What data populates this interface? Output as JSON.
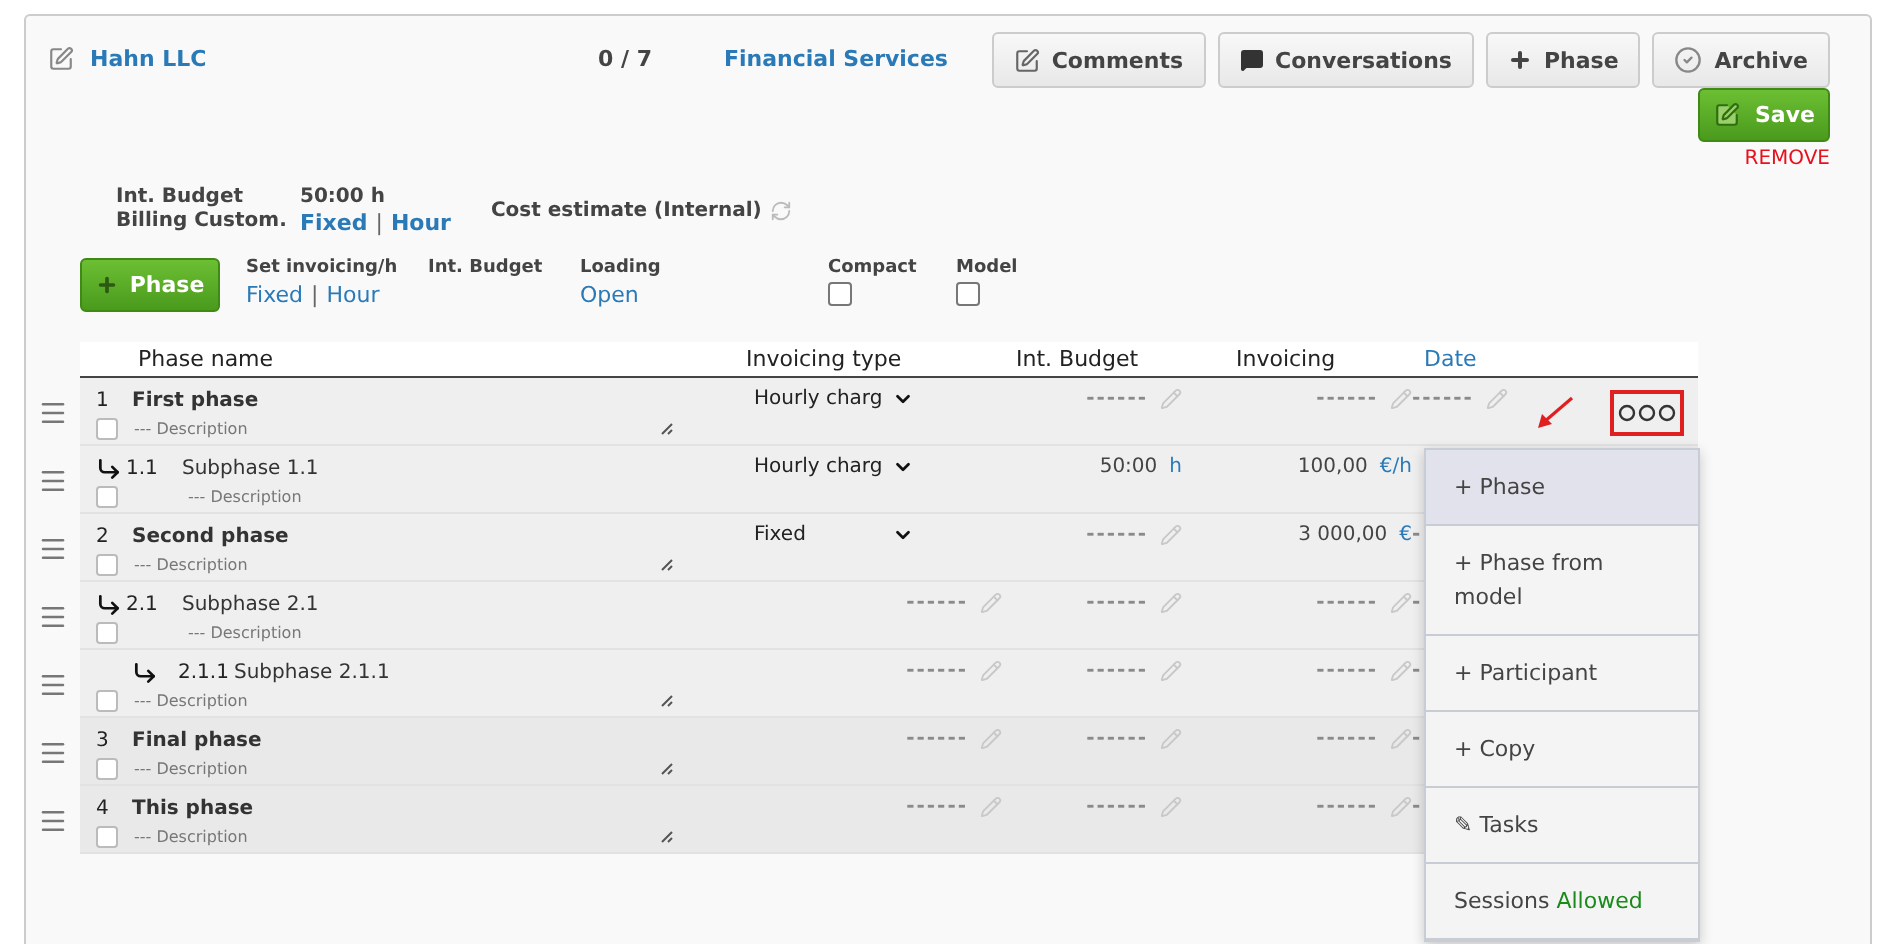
{
  "header": {
    "client": "Hahn LLC",
    "progress": "0 / 7",
    "category": "Financial Services"
  },
  "toolbar": [
    {
      "kind": "comments",
      "label": "Comments"
    },
    {
      "kind": "conversations",
      "label": "Conversations"
    },
    {
      "kind": "add",
      "label": "Phase"
    },
    {
      "kind": "archive",
      "label": "Archive"
    }
  ],
  "save": {
    "label": "Save",
    "remove": "REMOVE"
  },
  "summary": {
    "budget_label": "Int. Budget",
    "budget_value": "50:00 h",
    "billing_label": "Billing Custom.",
    "billing_options": [
      "Fixed",
      "Hour"
    ],
    "billing_separator": "|",
    "cost_estimate": "Cost estimate (Internal)"
  },
  "controls": {
    "add_phase": "Phase",
    "set_invoicing": {
      "label": "Set invoicing/h",
      "options": [
        "Fixed",
        "Hour"
      ],
      "separator": "|"
    },
    "int_budget": "Int. Budget",
    "loading": {
      "label": "Loading",
      "value": "Open"
    },
    "toggles": [
      {
        "label": "Compact",
        "checked": false
      },
      {
        "label": "Model",
        "checked": false
      }
    ]
  },
  "table": {
    "columns": [
      {
        "label": "Phase name",
        "link": false
      },
      {
        "label": "Invoicing type",
        "link": false
      },
      {
        "label": "Int. Budget",
        "link": false
      },
      {
        "label": "Invoicing",
        "link": false
      },
      {
        "label": "Date",
        "link": true
      }
    ],
    "rows": [
      {
        "number": "1",
        "name": "First phase",
        "description": "--- Description",
        "checked": false,
        "type": {
          "kind": "select",
          "value": "Hourly charg"
        },
        "budget": {
          "kind": "empty",
          "text": "------"
        },
        "invoicing": {
          "kind": "empty",
          "text": "------"
        },
        "date": {
          "kind": "empty",
          "text": "------"
        },
        "menu_open": true,
        "children": [
          {
            "number": "1.1",
            "name": "Subphase 1.1",
            "description": "--- Description",
            "checked": false,
            "type": {
              "kind": "select",
              "value": "Hourly charg"
            },
            "budget": {
              "kind": "value",
              "value": "50:00",
              "unit": "h"
            },
            "invoicing": {
              "kind": "value",
              "value": "100,00",
              "unit": "€/h"
            },
            "date": {
              "kind": "none"
            }
          }
        ]
      },
      {
        "number": "2",
        "name": "Second phase",
        "description": "--- Description",
        "checked": false,
        "type": {
          "kind": "select",
          "value": "Fixed"
        },
        "budget": {
          "kind": "empty",
          "text": "------"
        },
        "invoicing": {
          "kind": "value",
          "value": "3 000,00",
          "unit": "€"
        },
        "date": {
          "kind": "cut",
          "text": "-"
        },
        "children": [
          {
            "number": "2.1",
            "name": "Subphase 2.1",
            "description": "--- Description",
            "checked": false,
            "type": {
              "kind": "empty",
              "text": "------"
            },
            "budget": {
              "kind": "empty",
              "text": "------"
            },
            "invoicing": {
              "kind": "empty",
              "text": "------"
            },
            "date": {
              "kind": "cut",
              "text": "-"
            },
            "children": [
              {
                "number": "2.1.1",
                "name": "Subphase 2.1.1",
                "description": "--- Description",
                "checked": false,
                "type": {
                  "kind": "empty",
                  "text": "------"
                },
                "budget": {
                  "kind": "empty",
                  "text": "------"
                },
                "invoicing": {
                  "kind": "empty",
                  "text": "------"
                },
                "date": {
                  "kind": "cut",
                  "text": "-"
                }
              }
            ]
          }
        ]
      },
      {
        "number": "3",
        "name": "Final phase",
        "description": "--- Description",
        "checked": false,
        "type": {
          "kind": "empty",
          "text": "------"
        },
        "budget": {
          "kind": "empty",
          "text": "------"
        },
        "invoicing": {
          "kind": "empty",
          "text": "------"
        },
        "date": {
          "kind": "cut",
          "text": "-"
        }
      },
      {
        "number": "4",
        "name": "This phase",
        "description": "--- Description",
        "checked": false,
        "type": {
          "kind": "empty",
          "text": "------"
        },
        "budget": {
          "kind": "empty",
          "text": "------"
        },
        "invoicing": {
          "kind": "empty",
          "text": "------"
        },
        "date": {
          "kind": "cut",
          "text": "-"
        }
      }
    ]
  },
  "menu": [
    {
      "label": "+ Phase",
      "selected": true
    },
    {
      "label": "+ Phase from model",
      "selected": false
    },
    {
      "label": "+ Participant",
      "selected": false
    },
    {
      "label": "+ Copy",
      "selected": false
    },
    {
      "label": "✎ Tasks",
      "selected": false
    },
    {
      "label": "Sessions",
      "status": "Allowed",
      "selected": false
    }
  ]
}
